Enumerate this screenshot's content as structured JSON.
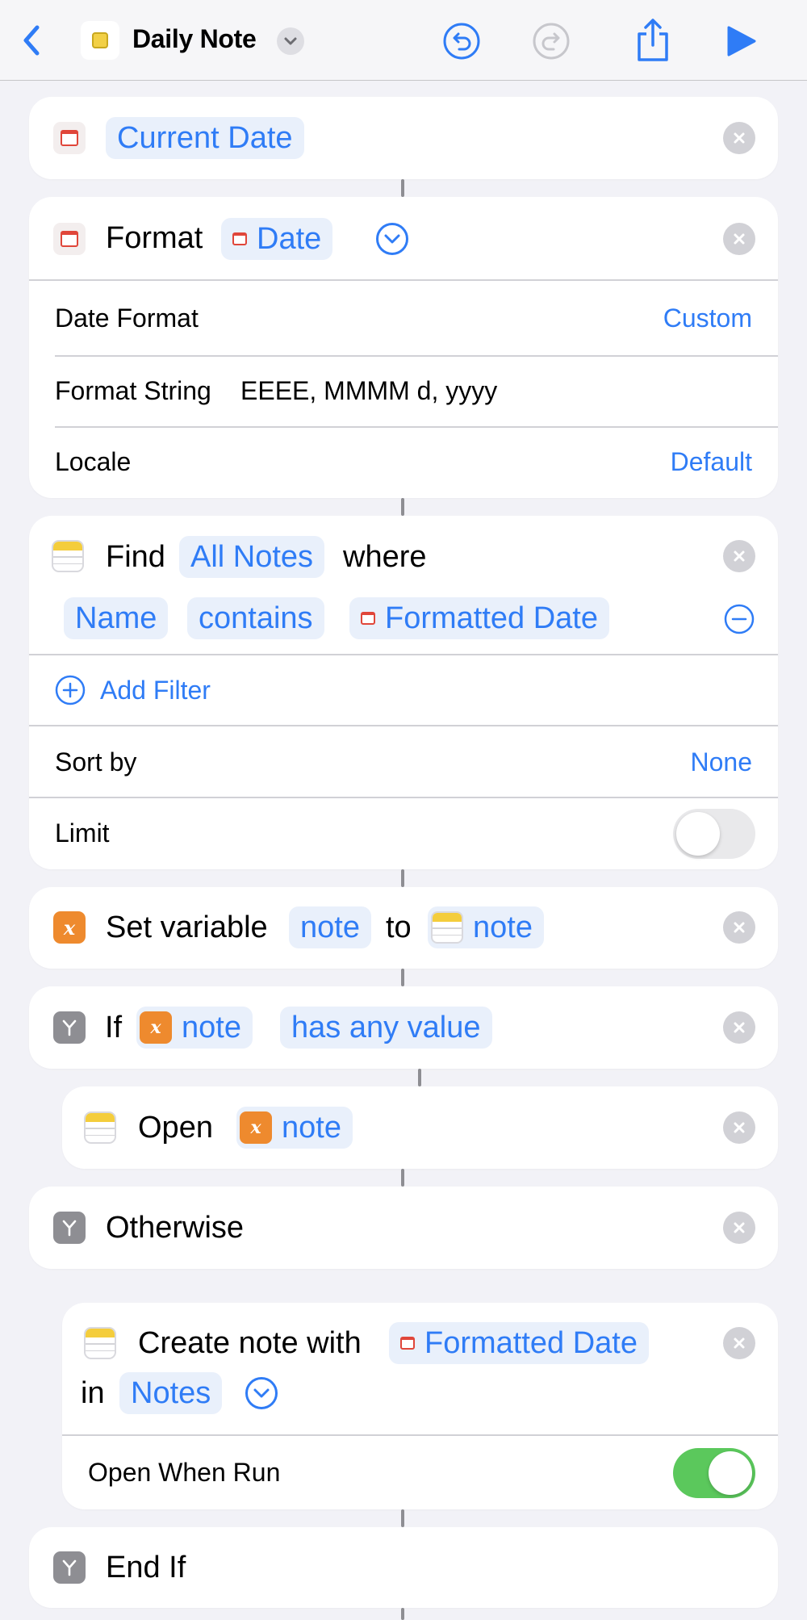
{
  "header": {
    "title": "Daily Note"
  },
  "actions": {
    "current_date": {
      "token": "Current Date"
    },
    "format_date": {
      "verb": "Format",
      "token": "Date",
      "date_format_label": "Date Format",
      "date_format_value": "Custom",
      "format_string_label": "Format String",
      "format_string_value": "EEEE, MMMM d, yyyy",
      "locale_label": "Locale",
      "locale_value": "Default"
    },
    "find_notes": {
      "verb": "Find",
      "token": "All Notes",
      "where": "where",
      "filter_field": "Name",
      "filter_op": "contains",
      "filter_value": "Formatted Date",
      "add_filter": "Add Filter",
      "sort_label": "Sort by",
      "sort_value": "None",
      "limit_label": "Limit",
      "limit_enabled": false
    },
    "set_variable": {
      "verb": "Set variable",
      "var_name": "note",
      "to": "to",
      "value": "note"
    },
    "if_block": {
      "verb": "If",
      "var": "note",
      "condition": "has any value"
    },
    "open_note": {
      "verb": "Open",
      "var": "note"
    },
    "otherwise": {
      "label": "Otherwise"
    },
    "create_note": {
      "verb": "Create note with",
      "token": "Formatted Date",
      "in": "in",
      "folder": "Notes",
      "open_when_run_label": "Open When Run",
      "open_when_run": true
    },
    "end_if": {
      "label": "End If"
    }
  },
  "colors": {
    "accent": "#2f7cf6",
    "background": "#f2f2f7",
    "variable": "#ee8a2e",
    "toggle_on": "#5bc85c"
  }
}
